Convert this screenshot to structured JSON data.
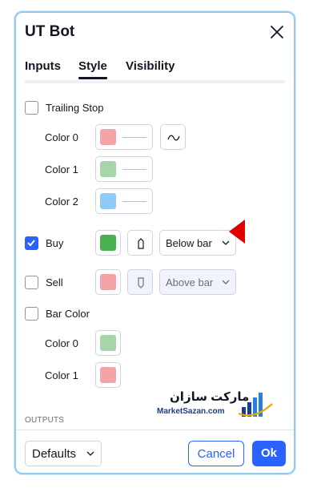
{
  "dialog": {
    "title": "UT Bot"
  },
  "tabs": [
    {
      "label": "Inputs",
      "active": false
    },
    {
      "label": "Style",
      "active": true
    },
    {
      "label": "Visibility",
      "active": false
    }
  ],
  "trailing_stop": {
    "label": "Trailing Stop",
    "checked": false,
    "colors": [
      {
        "label": "Color 0",
        "color": "#f4a3a7"
      },
      {
        "label": "Color 1",
        "color": "#a5d6a7"
      },
      {
        "label": "Color 2",
        "color": "#90caf9"
      }
    ],
    "plot_style_icon": "line-wave-icon"
  },
  "buy": {
    "label": "Buy",
    "checked": true,
    "color": "#4caf50",
    "shape_icon": "label-up-icon",
    "location": "Below bar"
  },
  "sell": {
    "label": "Sell",
    "checked": false,
    "color": "#f4a3a7",
    "shape_icon": "label-down-icon",
    "location": "Above bar"
  },
  "bar_color": {
    "label": "Bar Color",
    "checked": false,
    "colors": [
      {
        "label": "Color 0",
        "color": "#a5d6a7"
      },
      {
        "label": "Color 1",
        "color": "#f4a3a7"
      }
    ]
  },
  "watermark": {
    "name_fa": "مارکت سازان",
    "site": "MarketSazan.com"
  },
  "section": {
    "outputs": "OUTPUTS"
  },
  "footer": {
    "defaults": "Defaults",
    "cancel": "Cancel",
    "ok": "Ok"
  },
  "accent_color": "#2962ff",
  "annotation_arrow_color": "#e00000"
}
